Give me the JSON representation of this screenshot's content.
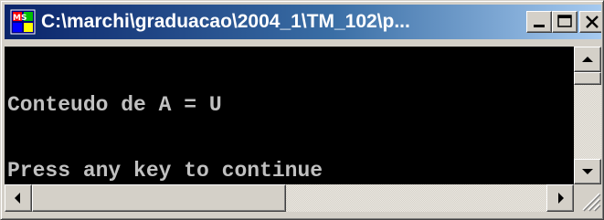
{
  "window": {
    "title": "C:\\marchi\\graduacao\\2004_1\\TM_102\\p...",
    "icon": "ms-dos-console-icon",
    "buttons": {
      "minimize": "minimize-icon",
      "maximize": "maximize-icon",
      "close": "close-icon"
    }
  },
  "console": {
    "lines": [
      "Conteudo de A = U",
      "Press any key to continue"
    ],
    "background": "#000000",
    "foreground": "#c0c0c0"
  },
  "scrollbars": {
    "vertical": {
      "position": 0
    },
    "horizontal": {
      "position": 0
    }
  },
  "colors": {
    "titlebar_start": "#0a246a",
    "titlebar_end": "#a6caf0",
    "chrome": "#d4d0c8"
  }
}
